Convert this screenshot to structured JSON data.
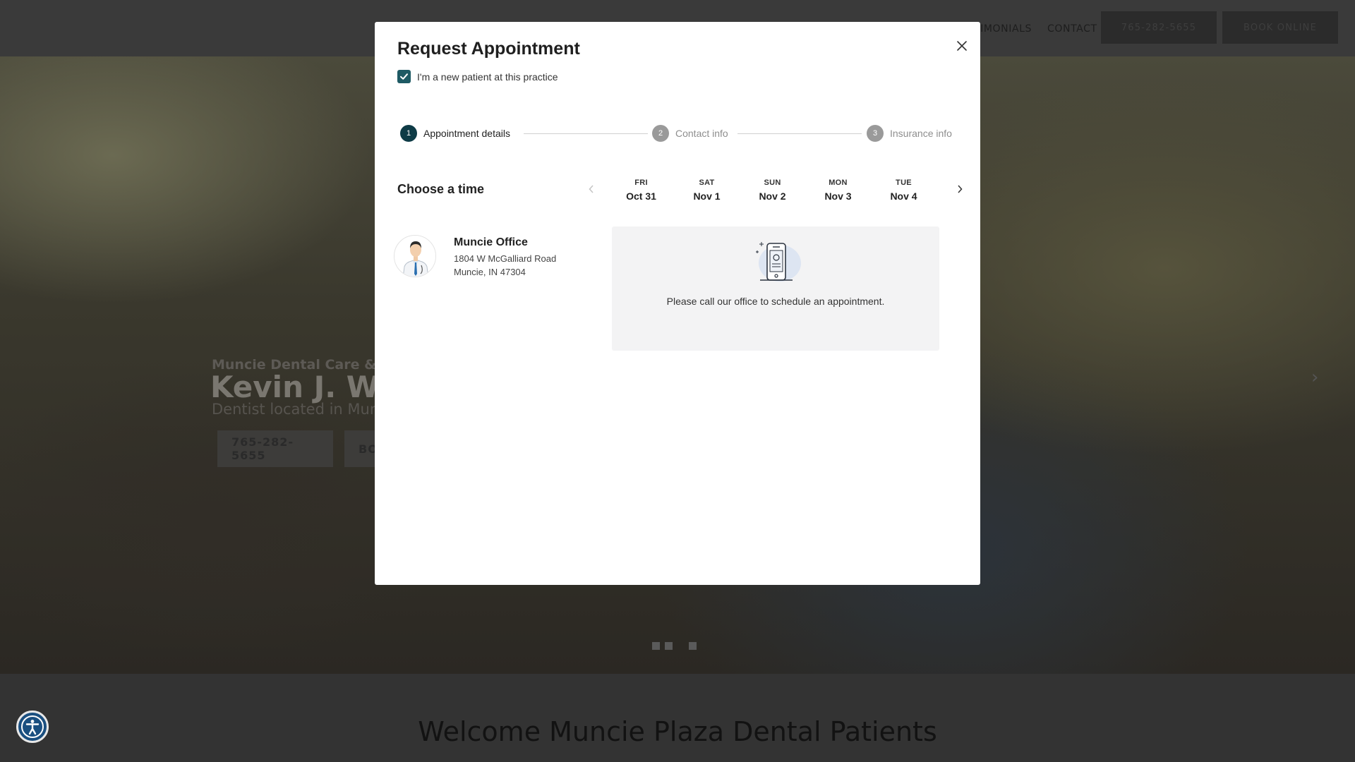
{
  "site": {
    "nav": {
      "testimonials": "TIMONIALS",
      "contact": "CONTACT"
    },
    "header_phone": "765-282-5655",
    "header_book": "BOOK ONLINE",
    "hero": {
      "subtitle": "Muncie Dental Care & Den",
      "title": "Kevin J. Welc",
      "tagline": "Dentist located in Munci",
      "phone_button": "765-282-5655",
      "book_button": "BO"
    },
    "welcome_title": "Welcome Muncie Plaza Dental Patients"
  },
  "modal": {
    "title": "Request Appointment",
    "close_icon": "close-icon",
    "new_patient_label": "I'm a new patient at this practice",
    "new_patient_checked": true,
    "steps": [
      {
        "num": "1",
        "label": "Appointment details",
        "state": "active"
      },
      {
        "num": "2",
        "label": "Contact info",
        "state": "inactive"
      },
      {
        "num": "3",
        "label": "Insurance info",
        "state": "inactive"
      }
    ],
    "choose_time_title": "Choose a time",
    "days": [
      {
        "dow": "FRI",
        "date": "Oct 31"
      },
      {
        "dow": "SAT",
        "date": "Nov 1"
      },
      {
        "dow": "SUN",
        "date": "Nov 2"
      },
      {
        "dow": "MON",
        "date": "Nov 3"
      },
      {
        "dow": "TUE",
        "date": "Nov 4"
      }
    ],
    "office": {
      "name": "Muncie Office",
      "address_line1": "1804 W McGalliard Road",
      "address_line2": "Muncie, IN 47304"
    },
    "call_message": "Please call our office to schedule an appointment."
  },
  "colors": {
    "accent": "#0e3b46",
    "checkbox": "#1e5a64",
    "accessibility": "#1a4f80"
  }
}
